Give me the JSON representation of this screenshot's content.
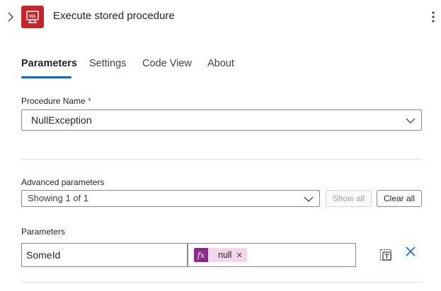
{
  "header": {
    "title": "Execute stored procedure",
    "logo_text": "SQL",
    "logo_color": "#c4262e"
  },
  "tabs": [
    {
      "label": "Parameters",
      "active": true
    },
    {
      "label": "Settings",
      "active": false
    },
    {
      "label": "Code View",
      "active": false
    },
    {
      "label": "About",
      "active": false
    }
  ],
  "procedure": {
    "label": "Procedure Name",
    "required_mark": "*",
    "value": "NullException"
  },
  "advanced": {
    "label": "Advanced parameters",
    "selected": "Showing 1 of 1",
    "show_all_label": "Show all",
    "clear_all_label": "Clear all"
  },
  "parameters": {
    "label": "Parameters",
    "rows": [
      {
        "key": "SomeId",
        "value_token": "null",
        "token_icon": "fx",
        "token_color": "#8a2a8a"
      }
    ]
  },
  "icons": {
    "expand": "chevron-right-icon",
    "more": "more-vertical-icon",
    "dropdown": "chevron-down-icon",
    "switch_mode": "text-mode-icon",
    "remove": "close-icon"
  },
  "colors": {
    "accent": "#0f6cbd",
    "brand_red": "#c4262e",
    "token_bg": "#f3d6ec"
  }
}
